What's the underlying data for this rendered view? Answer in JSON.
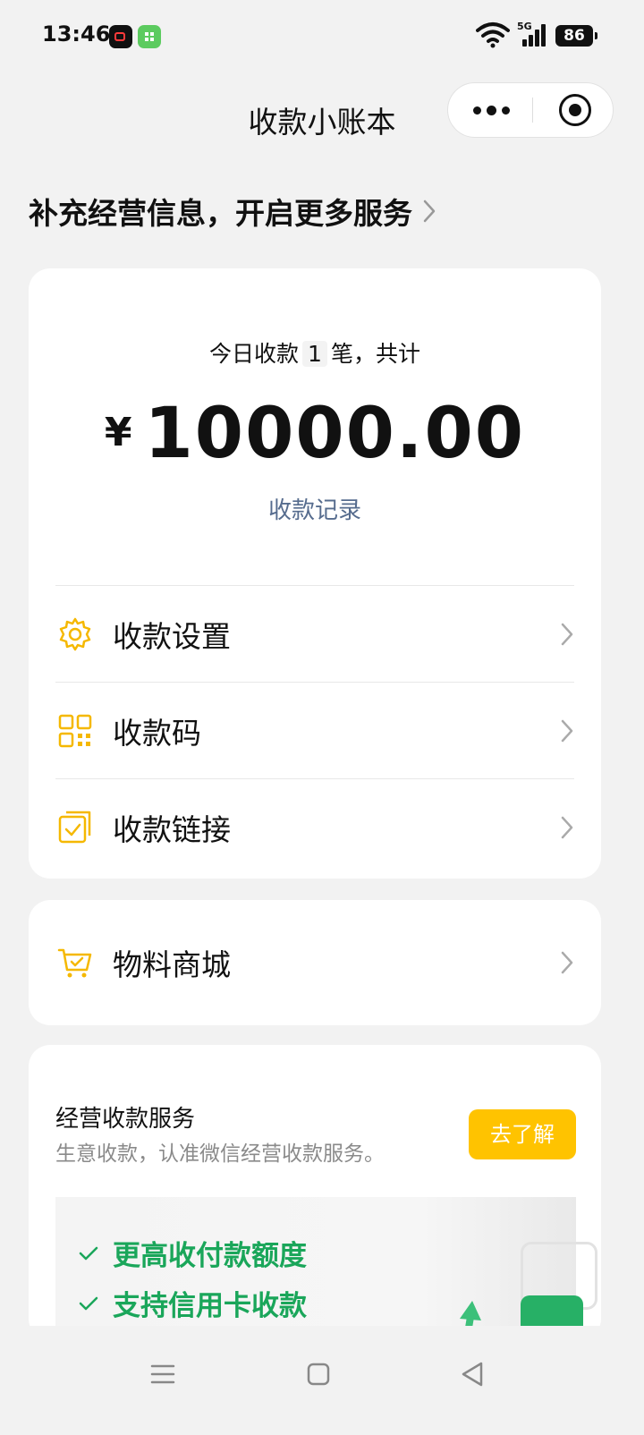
{
  "status_bar": {
    "time": "13:46",
    "network": "5G",
    "battery": "86"
  },
  "nav": {
    "title": "收款小账本",
    "more_icon": "more-dots-icon",
    "close_icon": "mini-program-close-icon"
  },
  "banner": {
    "text": "补充经营信息，开启更多服务"
  },
  "summary": {
    "prefix": "今日收款",
    "count": "1",
    "suffix": "笔，共计",
    "currency": "¥",
    "amount": "10000.00",
    "records_link": "收款记录"
  },
  "menu": [
    {
      "label": "收款设置",
      "icon": "gear-icon"
    },
    {
      "label": "收款码",
      "icon": "qr-code-icon"
    },
    {
      "label": "收款链接",
      "icon": "payment-link-icon"
    }
  ],
  "shop": {
    "label": "物料商城",
    "icon": "shopping-cart-icon"
  },
  "service": {
    "title": "经营收款服务",
    "subtitle": "生意收款，认准微信经营收款服务。",
    "button": "去了解",
    "features": [
      "更高收付款额度",
      "支持信用卡收款"
    ]
  },
  "colors": {
    "accent": "#ffc300",
    "icon_yellow": "#f5b800",
    "link": "#566c8e",
    "feature_green": "#1aa65a"
  }
}
